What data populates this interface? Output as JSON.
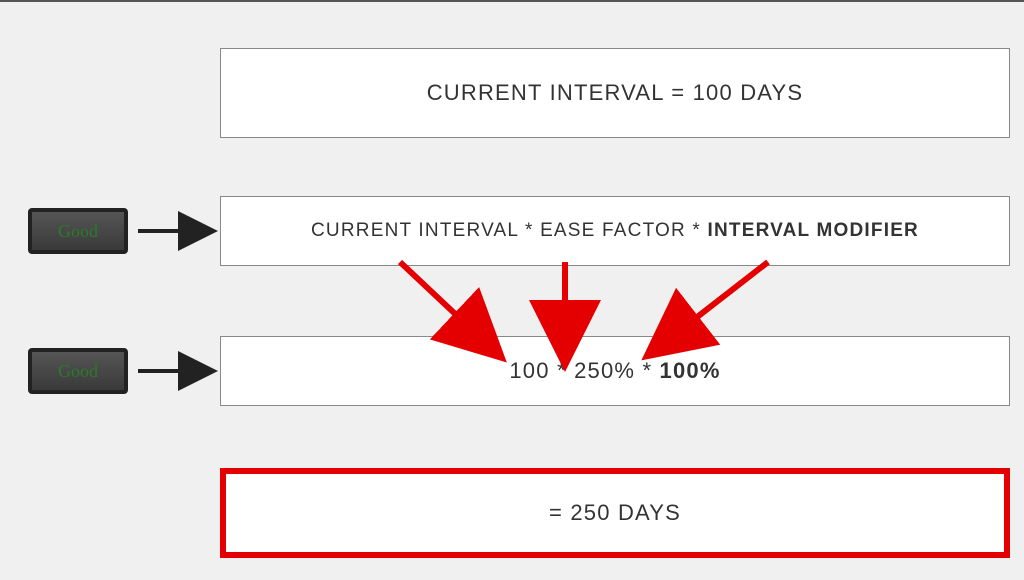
{
  "boxes": {
    "top": "CURRENT INTERVAL = 100 DAYS",
    "formula": {
      "p1": "CURRENT INTERVAL",
      "sep": " * ",
      "p2": "EASE FACTOR",
      "p3": "INTERVAL MODIFIER"
    },
    "values": {
      "p1": "100",
      "sep": " * ",
      "p2": "250%",
      "p3": "100%"
    },
    "result": "= 250 DAYS"
  },
  "buttons": {
    "good": "Good"
  },
  "colors": {
    "arrow_red": "#e40000",
    "arrow_black": "#222"
  },
  "chart_data": {
    "type": "flow_formula",
    "current_interval_days": 100,
    "ease_factor_percent": 250,
    "interval_modifier_percent": 100,
    "result_days": 250,
    "relation": "result_days = current_interval_days * (ease_factor_percent/100) * (interval_modifier_percent/100)",
    "answer_button": "Good"
  }
}
